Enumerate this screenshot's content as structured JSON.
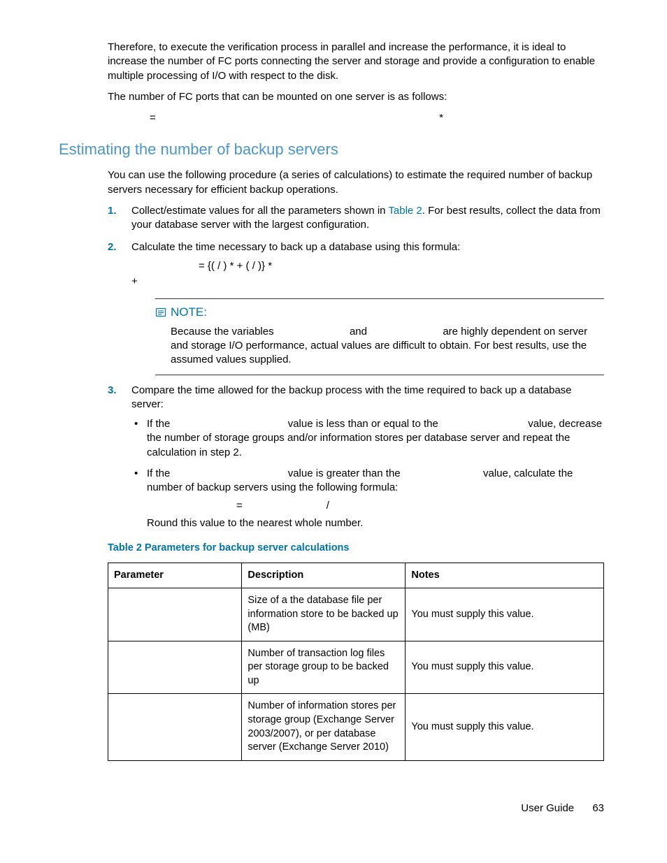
{
  "intro": {
    "para1": "Therefore, to execute the verification process in parallel and increase the performance, it is ideal to increase the number of FC ports connecting the server and storage and provide a configuration to enable multiple processing of I/O with respect to the disk.",
    "para2": "The number of FC ports that can be mounted on one server is as follows:",
    "formula_eq": "=",
    "formula_ast": "*"
  },
  "section": {
    "heading": "Estimating the number of backup servers",
    "lead": "You can use the following procedure (a series of calculations) to estimate the required number of backup servers necessary for efficient backup operations.",
    "steps": {
      "s1": {
        "num": "1.",
        "text_a": "Collect/estimate values for all the parameters shown in ",
        "link": "Table 2",
        "text_b": ". For best results, collect the data from your database server with the largest configuration."
      },
      "s2": {
        "num": "2.",
        "text": "Calculate the time necessary to back up a database using this formula:",
        "formula_line": "= {(      /                     ) *                 + (                  /                        )} *",
        "formula_plus": "+"
      },
      "note": {
        "label": "NOTE:",
        "body_a": "Because the variables ",
        "body_b": " and ",
        "body_c": " are highly dependent on server and storage I/O performance, actual values are difficult to obtain. For best results, use the assumed values supplied."
      },
      "s3": {
        "num": "3.",
        "text": "Compare the time allowed for the backup process with the time required to back up a database server:",
        "b1_a": "If the ",
        "b1_b": " value is less than or equal to the ",
        "b1_c": " value, decrease the number of storage groups and/or information stores per database server and repeat the calculation in step 2.",
        "b2_a": "If the ",
        "b2_b": " value is greater than the ",
        "b2_c": " value, calculate the number of backup servers using the following formula:",
        "formula_eq": "=",
        "formula_sl": "/",
        "round": "Round this value to the nearest whole number."
      }
    }
  },
  "table": {
    "caption": "Table 2 Parameters for backup server calculations",
    "headers": {
      "h1": "Parameter",
      "h2": "Description",
      "h3": "Notes"
    },
    "rows": [
      {
        "param": "",
        "desc": "Size of a the database file per information store to be backed up (MB)",
        "notes": "You must supply this value."
      },
      {
        "param": "",
        "desc": "Number of transaction log files per storage group to be backed up",
        "notes": "You must supply this value."
      },
      {
        "param": "",
        "desc": "Number of information stores per storage group (Exchange Server 2003/2007), or per database server (Exchange Server 2010)",
        "notes": "You must supply this value."
      }
    ]
  },
  "footer": {
    "label": "User Guide",
    "page": "63"
  }
}
